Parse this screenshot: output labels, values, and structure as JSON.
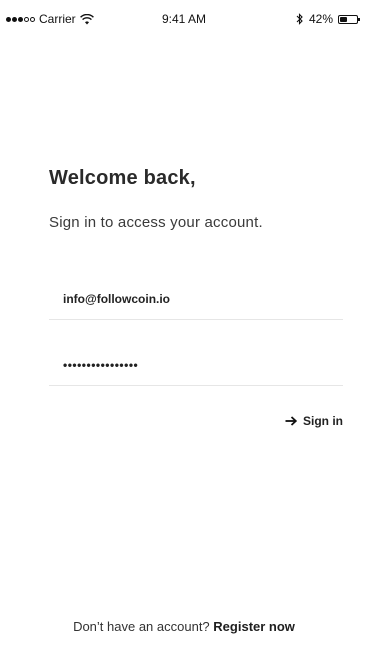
{
  "status_bar": {
    "carrier": "Carrier",
    "time": "9:41 AM",
    "battery_percent": "42%",
    "battery_level": 0.42,
    "signal_bars_filled": 3,
    "signal_bars_total": 5
  },
  "login": {
    "heading": "Welcome back,",
    "subheading": "Sign in to access your account.",
    "email_value": "info@followcoin.io",
    "password_value": "••••••••••••••••",
    "signin_label": "Sign in"
  },
  "footer": {
    "prompt": "Don’t have an account?",
    "register_label": "Register now"
  },
  "icons": {
    "wifi": "wifi-icon",
    "bluetooth": "bluetooth-icon",
    "battery": "battery-icon",
    "arrow": "arrow-right-icon"
  }
}
